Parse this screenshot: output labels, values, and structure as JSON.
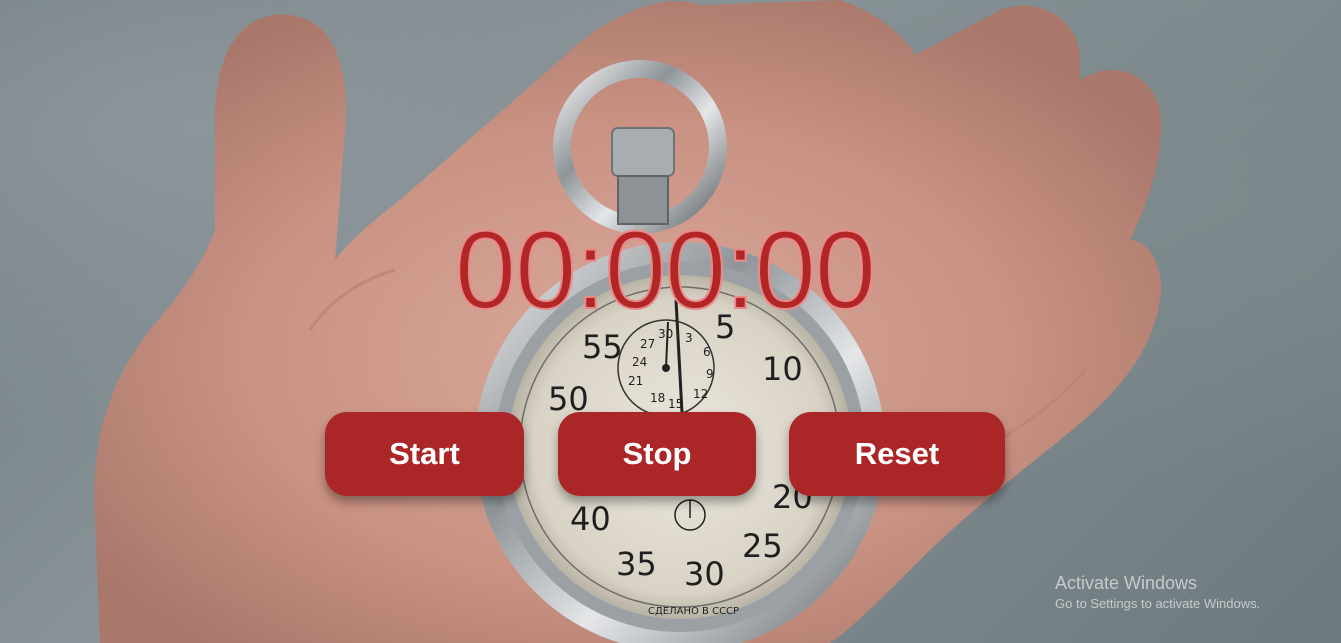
{
  "timer": {
    "display": "00:00:00"
  },
  "controls": {
    "start_label": "Start",
    "stop_label": "Stop",
    "reset_label": "Reset"
  },
  "background": {
    "description": "hand-holding-stopwatch-photo"
  },
  "stopwatch_dial": {
    "numbers": [
      "55",
      "5",
      "10",
      "50",
      "40",
      "35",
      "30",
      "25",
      "20"
    ],
    "subdial_numbers": [
      "30",
      "3",
      "27",
      "6",
      "24",
      "9",
      "21",
      "18",
      "15",
      "12"
    ],
    "inscription": "СДЕЛАНО В СССР"
  },
  "watermark": {
    "title": "Activate Windows",
    "subtitle": "Go to Settings to activate Windows."
  },
  "colors": {
    "accent": "#ab2626",
    "timer_text": "#b32626",
    "button_text": "#ffffff"
  }
}
